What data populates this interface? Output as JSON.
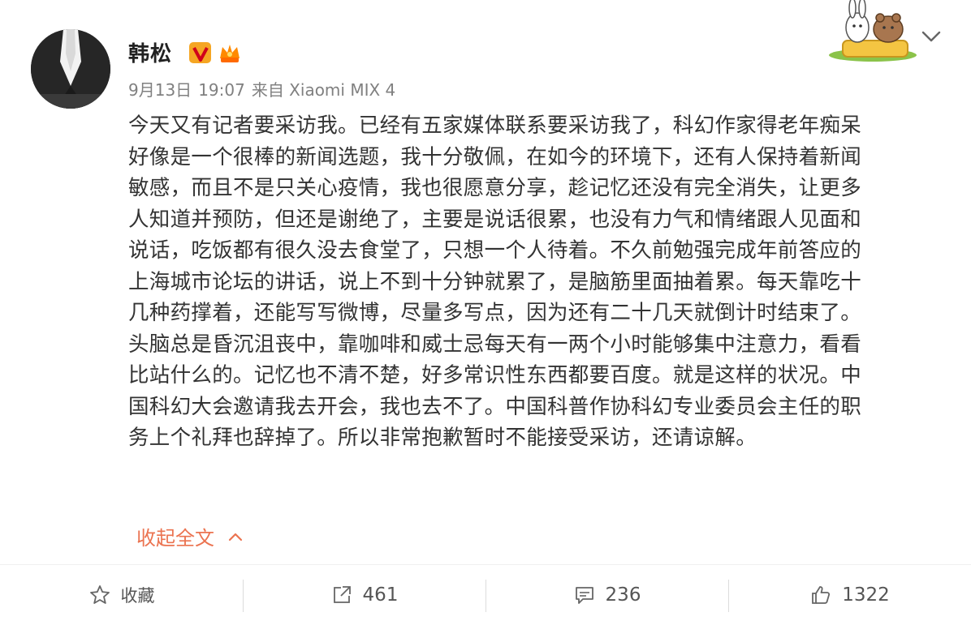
{
  "user": {
    "name": "韩松",
    "avatar_icon": "avatar-portrait",
    "badges": [
      "verified-v-icon",
      "vip-crown-icon"
    ]
  },
  "post": {
    "date": "9月13日",
    "time": "19:07",
    "source": "来自 Xiaomi MIX 4",
    "text": "今天又有记者要采访我。已经有五家媒体联系要采访我了，科幻作家得老年痴呆\n好像是一个很棒的新闻选题，我十分敬佩，在如今的环境下，还有人保持着新闻\n敏感，而且不是只关心疫情，我也很愿意分享，趁记忆还没有完全消失，让更多\n人知道并预防，但还是谢绝了，主要是说话很累，也没有力气和情绪跟人见面和\n说话，吃饭都有很久没去食堂了，只想一个人待着。不久前勉强完成年前答应的\n上海城市论坛的讲话，说上不到十分钟就累了，是脑筋里面抽着累。每天靠吃十\n几种药撑着，还能写写微博，尽量多写点，因为还有二十几天就倒计时结束了。\n头脑总是昏沉沮丧中，靠咖啡和威士忌每天有一两个小时能够集中注意力，看看\n比站什么的。记忆也不清不楚，好多常识性东西都要百度。就是这样的状况。中\n国科幻大会邀请我去开会，我也去不了。中国科普作协科幻专业委员会主任的职\n务上个礼拜也辞掉了。所以非常抱歉暂时不能接受采访，还请谅解。",
    "collapse_label": "收起全文"
  },
  "actions": {
    "favorite_label": "收藏",
    "repost_count": "461",
    "comment_count": "236",
    "like_count": "1322"
  },
  "colors": {
    "accent": "#eb7350",
    "text": "#333333",
    "meta": "#808080",
    "verified": "#f5a623"
  }
}
